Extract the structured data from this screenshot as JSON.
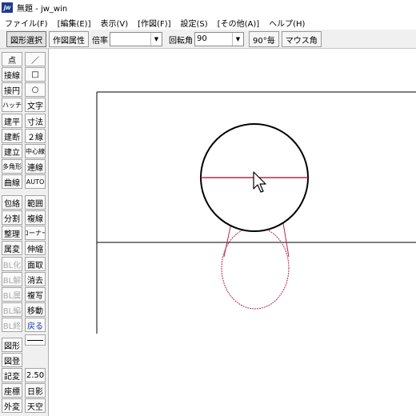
{
  "window": {
    "title": "無題 - jw_win",
    "app_icon_label": "jw"
  },
  "menu": [
    "ファイル(F)",
    "[編集(E)]",
    "表示(V)",
    "[作図(F)]",
    "設定(S)",
    "[その他(A)]",
    "ヘルプ(H)"
  ],
  "toolbar": {
    "select_button": "図形選択",
    "attr_button": "作図属性",
    "scale_label": "倍率",
    "scale_value": "",
    "rotation_label": "回転角",
    "rotation_value": "90",
    "step_button": "90°毎",
    "mouse_angle_button": "マウス角"
  },
  "tools_left": [
    "点",
    "接線",
    "接円",
    "ハッチ",
    "建平",
    "建断",
    "建立",
    "多角形",
    "曲線",
    "包絡",
    "分割",
    "整理",
    "属変",
    "BL化",
    "BL解",
    "BL属",
    "BL編",
    "BL終",
    "図形",
    "図登",
    "記変",
    "座標",
    "外変"
  ],
  "tools_right": [
    "／",
    "□",
    "○",
    "文字",
    "寸法",
    "２線",
    "中心線",
    "連線",
    "AUTO",
    "範囲",
    "複線",
    "コーナー",
    "伸縮",
    "面取",
    "消去",
    "複写",
    "移動",
    "戻る",
    "",
    "2.50",
    "日影",
    "天空"
  ],
  "colors": {
    "curve": "#b42a4c",
    "line": "#000000",
    "disabled": "#a9a9a9",
    "undo": "#1b2fb0"
  },
  "cursor": "mouse-pointer-icon"
}
